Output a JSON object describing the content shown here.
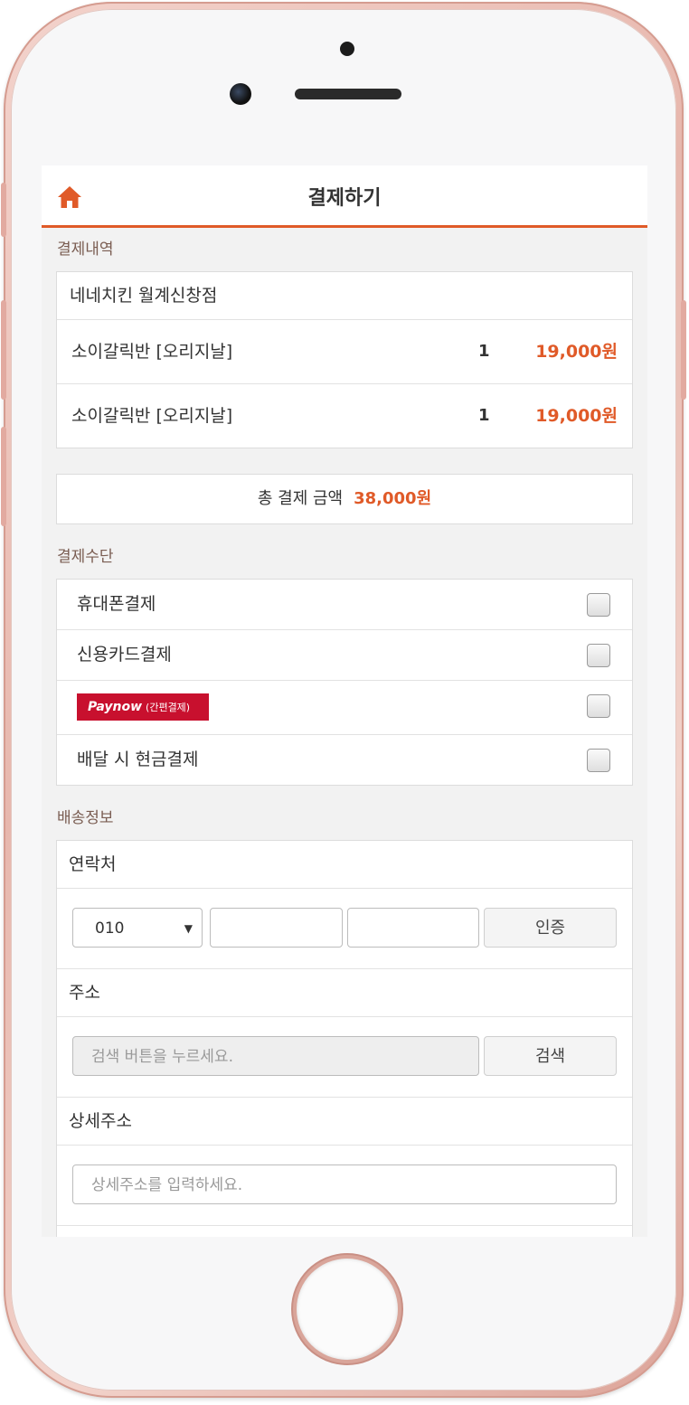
{
  "header": {
    "title": "결제하기"
  },
  "order": {
    "section_label": "결제내역",
    "store_name": "네네치킨 월계신창점",
    "items": [
      {
        "name": "소이갈릭반 [오리지날]",
        "qty": "1",
        "price": "19,000원"
      },
      {
        "name": "소이갈릭반 [오리지날]",
        "qty": "1",
        "price": "19,000원"
      }
    ],
    "total_label": "총 결제 금액",
    "total_amount": "38,000원"
  },
  "payment": {
    "section_label": "결제수단",
    "options": [
      {
        "label": "휴대폰결제",
        "checked": false
      },
      {
        "label": "신용카드결제",
        "checked": false
      },
      {
        "label": "",
        "checked": false
      },
      {
        "label": "배달 시 현금결제",
        "checked": false
      }
    ],
    "paynow": {
      "brand": "Paynow",
      "suffix": "(간편결제)"
    }
  },
  "delivery": {
    "section_label": "배송정보",
    "contact": {
      "title": "연락처",
      "prefix_value": "010",
      "verify_label": "인증"
    },
    "address": {
      "title": "주소",
      "placeholder": "검색 버튼을 누르세요.",
      "search_label": "검색"
    },
    "detail": {
      "title": "상세주소",
      "placeholder": "상세주소를 입력하세요."
    }
  },
  "colors": {
    "accent": "#e05a28",
    "paynow": "#c8102e"
  },
  "icons": {
    "home": "home-icon",
    "select_arrow": "caret-down-icon"
  }
}
